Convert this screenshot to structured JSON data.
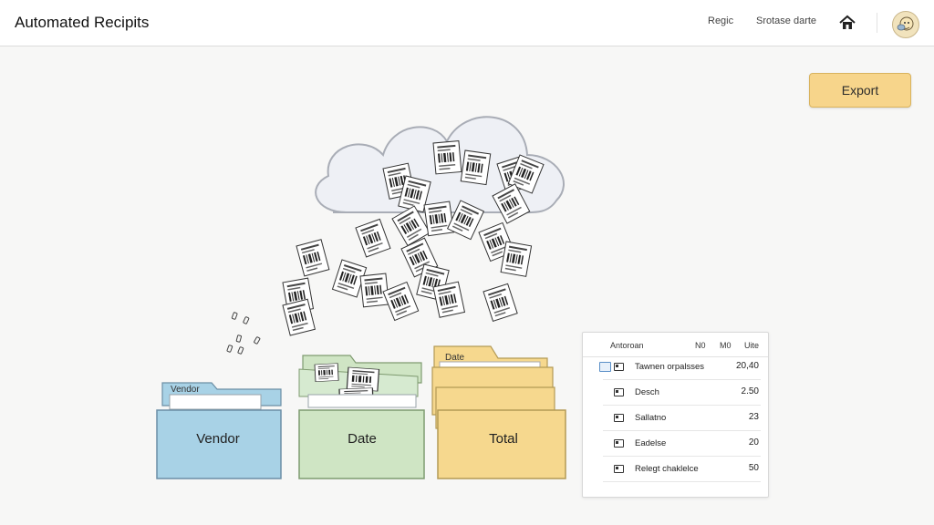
{
  "header": {
    "app_title": "Automated Recipits",
    "nav": [
      "Regic",
      "Srotase darte"
    ],
    "home_icon": "home-icon",
    "avatar_icon": "user-avatar-icon"
  },
  "actions": {
    "export_label": "Export"
  },
  "folders": [
    {
      "tab": "Vendor",
      "label": "Vendor",
      "color": "#a8d2e6"
    },
    {
      "tab": "",
      "label": "Date",
      "color": "#cfe5c4"
    },
    {
      "tab": "Date",
      "label": "Total",
      "color": "#f6d88e"
    }
  ],
  "summary_panel": {
    "columns": [
      "Antoroan",
      "N0",
      "M0",
      "Uite"
    ],
    "rows": [
      {
        "name": "Tawnen orpalsses",
        "value": "20,40"
      },
      {
        "name": "Desch",
        "value": "2.50"
      },
      {
        "name": "Sallatno",
        "value": "23"
      },
      {
        "name": "Eadelse",
        "value": "20"
      },
      {
        "name": "Relegt chaklelce",
        "value": "50"
      }
    ]
  },
  "colors": {
    "accent": "#f7d58b",
    "cloud": "#f3f4f8",
    "folder_blue": "#a8d2e6",
    "folder_green": "#cfe5c4",
    "folder_yellow": "#f6d88e"
  }
}
